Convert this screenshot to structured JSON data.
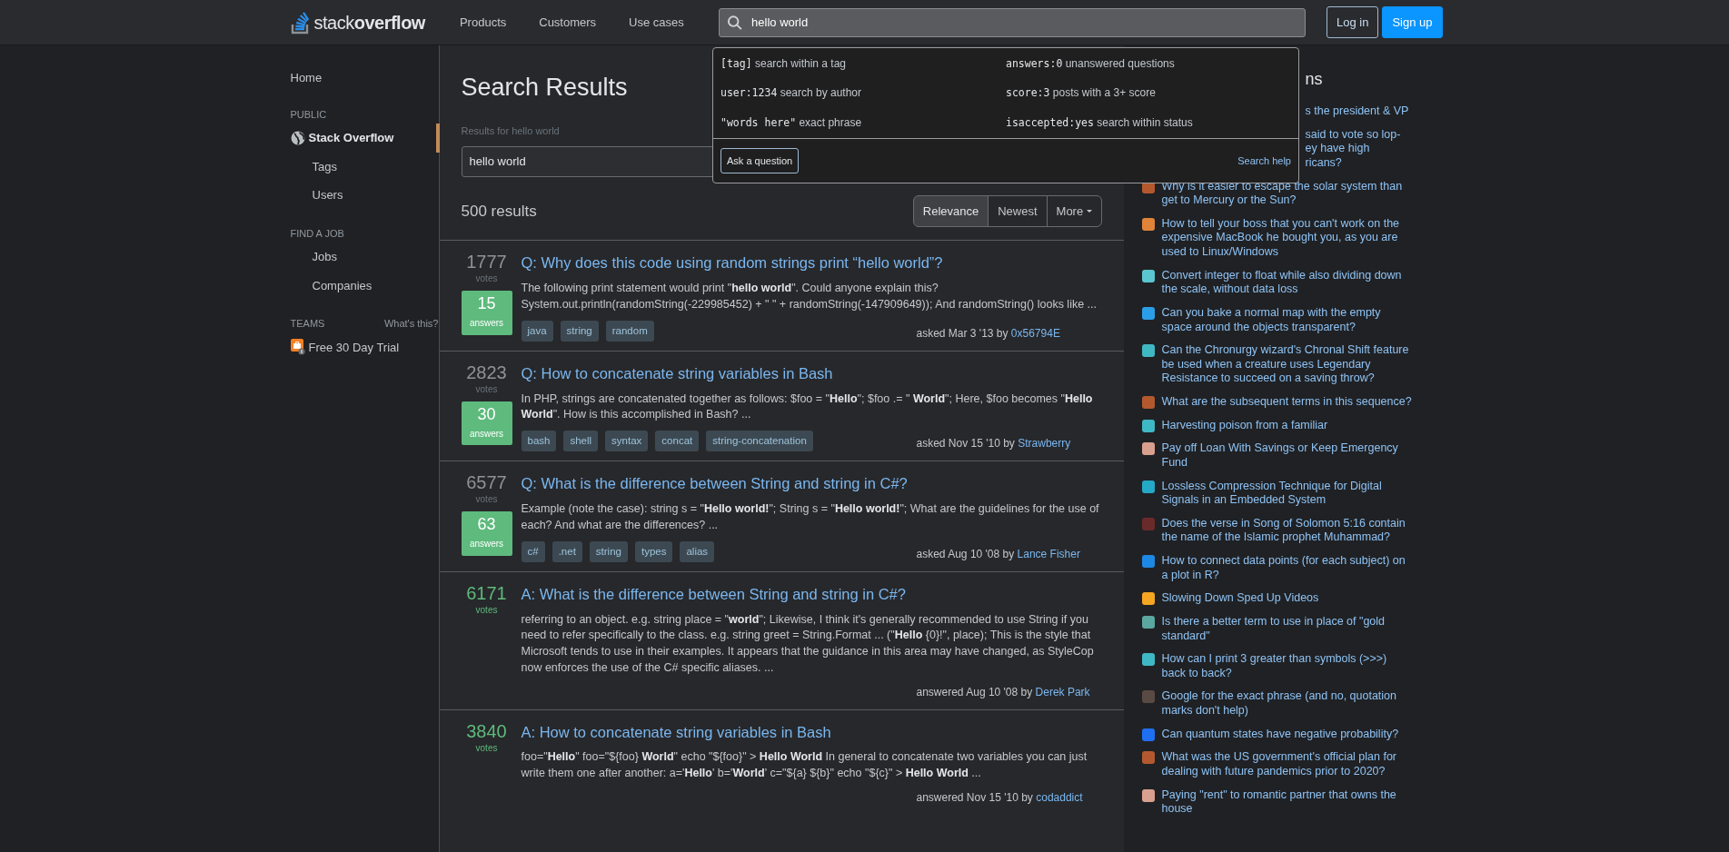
{
  "header": {
    "logo": "stack**overflow**",
    "nav": [
      "Products",
      "Customers",
      "Use cases"
    ],
    "search": {
      "value": "hello world"
    },
    "buttons": [
      {
        "label": "Log in",
        "kind": "outline"
      },
      {
        "label": "Sign up",
        "kind": "primary"
      }
    ]
  },
  "search_popover": {
    "hints": [
      {
        "code": "[tag]",
        "text": "search within a tag"
      },
      {
        "code": "answers:0",
        "text": "unanswered questions"
      },
      {
        "code": "user:1234",
        "text": "search by author"
      },
      {
        "code": "score:3",
        "text": "posts with a 3+ score"
      },
      {
        "code": "\"words here\"",
        "text": "exact phrase"
      },
      {
        "code": "isaccepted:yes",
        "text": "search within status"
      }
    ],
    "ask_button": "Ask a question",
    "help_link": "Search help"
  },
  "sidebar": {
    "items": [
      {
        "kind": "link",
        "label": "Home",
        "selected": false
      },
      {
        "kind": "heading",
        "label": "PUBLIC"
      },
      {
        "kind": "site",
        "label": "Stack Overflow",
        "selected": true
      },
      {
        "kind": "sublink",
        "label": "Tags",
        "selected": false
      },
      {
        "kind": "sublink",
        "label": "Users",
        "selected": false
      },
      {
        "kind": "heading",
        "label": "FIND A JOB"
      },
      {
        "kind": "sublink",
        "label": "Jobs",
        "selected": false
      },
      {
        "kind": "sublink",
        "label": "Companies",
        "selected": false
      },
      {
        "kind": "heading",
        "label": "TEAMS",
        "aside": "What's this?"
      },
      {
        "kind": "teams",
        "label": "Free 30 Day Trial",
        "selected": false
      }
    ]
  },
  "main": {
    "title": "Search Results",
    "results_for": "Results for hello world",
    "query": "hello world",
    "count": "500 results",
    "sort": [
      {
        "label": "Relevance",
        "selected": true,
        "kind": "tab"
      },
      {
        "label": "Newest",
        "selected": false,
        "kind": "tab"
      },
      {
        "label": "More",
        "selected": false,
        "kind": "dropdown"
      }
    ],
    "results": [
      {
        "kind": "question",
        "votes": "1777",
        "votes_label": "votes",
        "answers": "15",
        "answers_label": "answers",
        "title": "Q: Why does this code using random strings print “hello world”?",
        "excerpt": "The following print statement would print \"**hello world**\". Could anyone explain this? System.out.println(randomString(-229985452) + \" \" + randomString(-147909649)); And randomString() looks like ...",
        "tags": [
          "java",
          "string",
          "random"
        ],
        "meta": "asked Mar 3 '13 by",
        "user": "0x56794E"
      },
      {
        "kind": "question",
        "votes": "2823",
        "votes_label": "votes",
        "answers": "30",
        "answers_label": "answers",
        "title": "Q: How to concatenate string variables in Bash",
        "excerpt": "In PHP, strings are concatenated together as follows: $foo = \"**Hello**\"; $foo .= \" **World**\"; Here, $foo becomes \"**Hello World**\". How is this accomplished in Bash? ...",
        "tags": [
          "bash",
          "shell",
          "syntax",
          "concat",
          "string-concatenation"
        ],
        "meta": "asked Nov 15 '10 by",
        "user": "Strawberry"
      },
      {
        "kind": "question",
        "votes": "6577",
        "votes_label": "votes",
        "answers": "63",
        "answers_label": "answers",
        "title": "Q: What is the difference between String and string in C#?",
        "excerpt": "Example (note the case): string s = \"**Hello world!**\"; String s = \"**Hello world!**\"; What are the guidelines for the use of each? And what are the differences? ...",
        "tags": [
          "c#",
          ".net",
          "string",
          "types",
          "alias"
        ],
        "meta": "asked Aug 10 '08 by",
        "user": "Lance Fisher"
      },
      {
        "kind": "answer",
        "votes": "6171",
        "votes_label": "votes",
        "title": "A: What is the difference between String and string in C#?",
        "excerpt": "referring to an object. e.g. string place = \"**world**\"; Likewise, I think it's generally recommended to use String if you need to refer specifically to the class. e.g. string greet = String.Format ... (\"**Hello** {0}!\", place); This is the style that Microsoft tends to use in their examples. It appears that the guidance in this area may have changed, as StyleCop now enforces the use of the C# specific aliases. ...",
        "meta": "answered Aug 10 '08 by",
        "user": "Derek Park"
      },
      {
        "kind": "answer",
        "votes": "3840",
        "votes_label": "votes",
        "title": "A: How to concatenate string variables in Bash",
        "excerpt": "foo=\"**Hello**\" foo=\"${foo} **World**\" echo \"${foo}\" > **Hello World** In general to concatenate two variables you can just write them one after another: a='**Hello**' b='**World**' c=\"${a} ${b}\" echo \"${c}\" > **Hello World** ...",
        "meta": "answered Nov 15 '10 by",
        "user": "codaddict"
      }
    ]
  },
  "hot_network": {
    "title": "ns",
    "items": [
      {
        "covered": true,
        "lines": [
          "s the president & VP"
        ]
      },
      {
        "covered": true,
        "lines": [
          "said to vote so lop-",
          "ey have high",
          "ricans?"
        ]
      },
      {
        "covered": false,
        "color": "#b3592d",
        "lines": [
          "Why is it easier to escape the solar system than get to Mercury or the Sun?"
        ]
      },
      {
        "covered": false,
        "color": "#e0843a",
        "lines": [
          "How to tell your boss that you can't work on the expensive MacBook he bought you, as you are used to Linux/Windows"
        ]
      },
      {
        "covered": false,
        "color": "#5bc6d0",
        "lines": [
          "Convert integer to float while also dividing down the scale, without data loss"
        ]
      },
      {
        "covered": false,
        "color": "#2a9fe8",
        "lines": [
          "Can you bake a normal map with the empty space around the objects transparent?"
        ]
      },
      {
        "covered": false,
        "color": "#3fb8c4",
        "lines": [
          "Can the Chronurgy wizard's Chronal Shift feature be used when a creature uses Legendary Resistance to succeed on a saving throw?"
        ]
      },
      {
        "covered": false,
        "color": "#b3592e",
        "lines": [
          "What are the subsequent terms in this sequence?"
        ]
      },
      {
        "covered": false,
        "color": "#3fb8c5",
        "lines": [
          "Harvesting poison from a familiar"
        ]
      },
      {
        "covered": false,
        "color": "#d9a08f",
        "lines": [
          "Pay off Loan With Savings or Keep Emergency Fund"
        ]
      },
      {
        "covered": false,
        "color": "#25a8c6",
        "lines": [
          "Lossless Compression Technique for Digital Signals in an Embedded System"
        ]
      },
      {
        "covered": false,
        "color": "#6b2a2a",
        "lines": [
          "Does the verse in Song of Solomon 5:16 contain the name of the Islamic prophet Muhammad?"
        ]
      },
      {
        "covered": false,
        "color": "#1e88e5",
        "lines": [
          "How to connect data points (for each subject) on a plot in R?"
        ]
      },
      {
        "covered": false,
        "color": "#f5a623",
        "lines": [
          "Slowing Down Sped Up Videos"
        ]
      },
      {
        "covered": false,
        "color": "#5ba8a0",
        "lines": [
          "Is there a better term to use in place of \"gold standard\""
        ]
      },
      {
        "covered": false,
        "color": "#3fb8c6",
        "lines": [
          "How can I print 3 greater than symbols (>>>) back to back?"
        ]
      },
      {
        "covered": false,
        "color": "#5a4a44",
        "lines": [
          "Google for the exact phrase (and no, quotation marks don't help)"
        ]
      },
      {
        "covered": false,
        "color": "#1f6ff2",
        "lines": [
          "Can quantum states have negative probability?"
        ]
      },
      {
        "covered": false,
        "color": "#b3592f",
        "lines": [
          "What was the US government's official plan for dealing with future pandemics prior to 2020?"
        ]
      },
      {
        "covered": false,
        "color": "#d9a090",
        "lines": [
          "Paying \"rent\" to romantic partner that owns the house"
        ]
      }
    ]
  }
}
